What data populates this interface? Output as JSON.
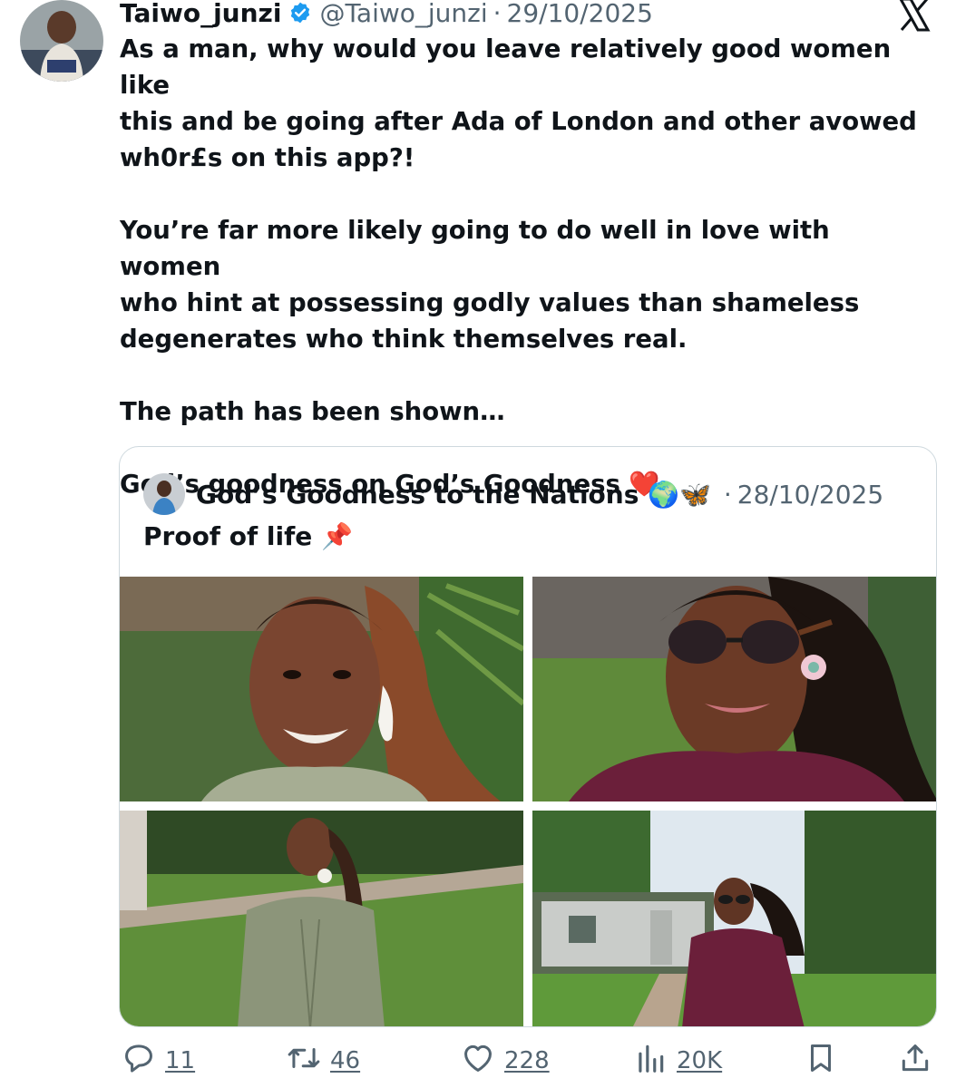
{
  "tweet": {
    "display_name": "Taiwo_junzi",
    "handle": "@Taiwo_junzi",
    "separator": "·",
    "date": "29/10/2025",
    "verified_icon": "verified-badge-icon",
    "platform_icon": "x-logo-icon",
    "text": {
      "line1": "As a man, why would you leave relatively good women like",
      "line2": "this and be going after Ada of London and other avowed",
      "line3": "wh0r£s on this app?!",
      "line4": "You’re far more likely going to do well in love with women",
      "line5": "who hint at possessing godly values than shameless",
      "line6": "degenerates who think themselves real.",
      "line7": "The path has been shown…",
      "line8": "God’s goodness on God’s Goodness ❤️"
    }
  },
  "quote": {
    "display_name": "God’s Goodness to the Nations 🌍🦋",
    "separator": "·",
    "date": "28/10/2025",
    "text": "Proof of life 📌",
    "photos": [
      "photo-1",
      "photo-2",
      "photo-3",
      "photo-4"
    ]
  },
  "actions": {
    "reply_count": "11",
    "retweet_count": "46",
    "like_count": "228",
    "views_count": "20K"
  },
  "colors": {
    "text_primary": "#0f1419",
    "text_secondary": "#536471",
    "verified_blue": "#1d9bf0",
    "border": "#cfd9de"
  }
}
